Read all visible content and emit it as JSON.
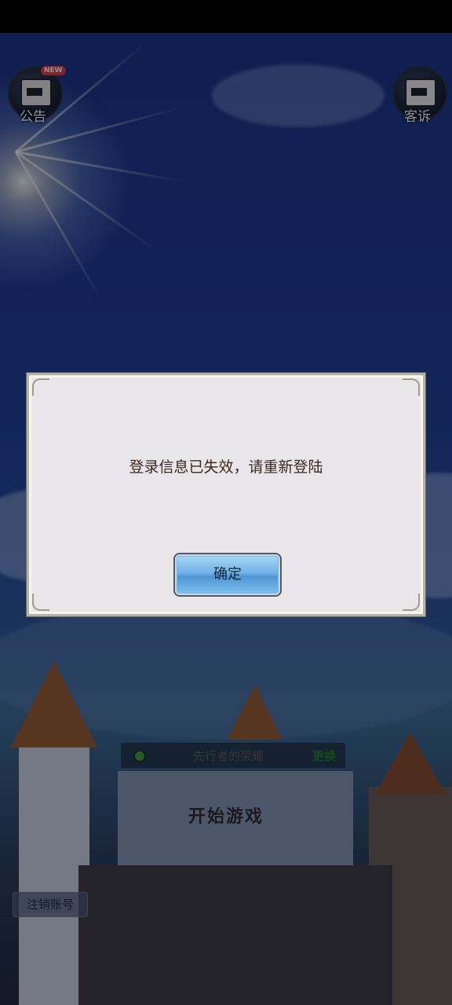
{
  "top_bar": {
    "announcement_label": "公告",
    "announcement_badge": "NEW",
    "support_label": "客诉"
  },
  "dialog": {
    "message": "登录信息已失效，请重新登陆",
    "confirm_label": "确定"
  },
  "server": {
    "name": "先行者的荣耀",
    "change_label": "更换",
    "status_color": "#3da12e"
  },
  "start_label": "开始游戏",
  "logout_label": "注销账号"
}
